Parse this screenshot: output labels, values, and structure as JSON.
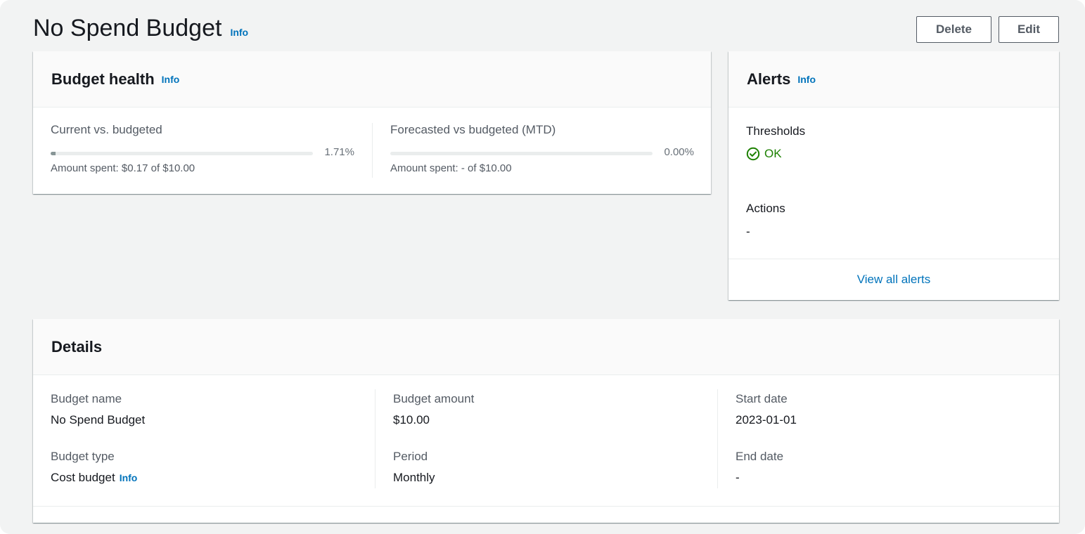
{
  "header": {
    "title": "No Spend Budget",
    "info": "Info",
    "delete_label": "Delete",
    "edit_label": "Edit"
  },
  "budget_health": {
    "title": "Budget health",
    "info": "Info",
    "current": {
      "label": "Current vs. budgeted",
      "percent_text": "1.71%",
      "progress_fraction": 0.0171,
      "amount_text": "Amount spent: $0.17 of $10.00"
    },
    "forecasted": {
      "label": "Forecasted vs budgeted (MTD)",
      "percent_text": "0.00%",
      "progress_fraction": 0,
      "amount_text": "Amount spent: - of $10.00"
    }
  },
  "alerts": {
    "title": "Alerts",
    "info": "Info",
    "thresholds_label": "Thresholds",
    "thresholds_status": "OK",
    "actions_label": "Actions",
    "actions_value": "-",
    "view_all": "View all alerts"
  },
  "details": {
    "title": "Details",
    "budget_name_label": "Budget name",
    "budget_name": "No Spend Budget",
    "budget_type_label": "Budget type",
    "budget_type": "Cost budget",
    "budget_type_info": "Info",
    "budget_amount_label": "Budget amount",
    "budget_amount": "$10.00",
    "period_label": "Period",
    "period": "Monthly",
    "start_date_label": "Start date",
    "start_date": "2023-01-01",
    "end_date_label": "End date",
    "end_date": "-"
  },
  "colors": {
    "link": "#0073bb",
    "success": "#1d8102",
    "progress_fill": "#879596"
  },
  "icons": {
    "status_ok": "check-circle-icon"
  }
}
